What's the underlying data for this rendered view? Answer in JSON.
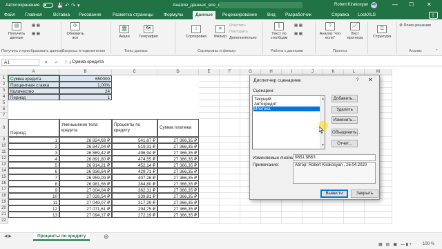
{
  "titlebar": {
    "autosave": "Автосохранение",
    "toggle_state": "Откл.",
    "doc_title": "Анализ_данных_все_функции.xlsx",
    "search_placeholder": "",
    "user": "Robert Kirakosyan",
    "initials": "RK",
    "minimize": "—",
    "maximize": "☐",
    "close": "✕"
  },
  "tabs": [
    "Файл",
    "Главная",
    "Вставка",
    "Рисование",
    "Разметка страницы",
    "Формулы",
    "Данные",
    "Рецензирование",
    "Вид",
    "Разработчик",
    "Справка",
    "LockXLS"
  ],
  "active_tab": "Данные",
  "share_label": "",
  "ribbon": {
    "get_data": "Получить\nданные",
    "refresh_all": "Обновить\nвсе",
    "stocks": "Акции",
    "geography": "География",
    "sort": "Сортировка",
    "filter": "Фильтр",
    "clear": "Очистить",
    "reapply": "Повторить",
    "advanced": "Дополнительно",
    "text_to_columns": "Текст по\nстолбцам",
    "what_if": "Анализ \"что\nесли\"",
    "forecast_sheet": "Лист\nпрогноза",
    "outline": "Структура",
    "solver": "Поиск решения",
    "groups": [
      "Получить и преобразовать данные",
      "Запросы и подключения",
      "Типы данных",
      "Сортировка и фильтр",
      "Работа с данными",
      "Прогноз",
      "Анализ"
    ]
  },
  "formula_bar": {
    "namebox": "A1",
    "controls": "✕ ✓ fx",
    "value": "Сумма кредита"
  },
  "columns": [
    "A",
    "B",
    "C",
    "D",
    "E",
    "F",
    "G",
    "H",
    "I",
    "J",
    "K",
    "L",
    "M"
  ],
  "rows": [
    "1",
    "2",
    "3",
    "4",
    "5",
    "6",
    "7",
    "8",
    "9",
    "10",
    "11",
    "12",
    "13",
    "14",
    "15",
    "16",
    "17",
    "18",
    "19",
    "20",
    "21",
    "22"
  ],
  "params": [
    {
      "label": "Сумма кредита",
      "value": "650000"
    },
    {
      "label": "Процентная ставка",
      "value": "1,00%"
    },
    {
      "label": "Количество",
      "value": "24"
    },
    {
      "label": "Период",
      "value": "1"
    }
  ],
  "table": {
    "headers": [
      "Период",
      "Уменьшение тела кредита",
      "Проценты по кредиту",
      "Сумма платежа"
    ],
    "rows": [
      [
        "1",
        "26 824,69 ₽",
        "541,67 ₽",
        "27 366,35 ₽"
      ],
      [
        "2",
        "26 847,04 ₽",
        "519,31 ₽",
        "27 366,35 ₽"
      ],
      [
        "3",
        "26 869,42 ₽",
        "496,94 ₽",
        "27 366,35 ₽"
      ],
      [
        "4",
        "26 891,80 ₽",
        "474,55 ₽",
        "27 366,35 ₽"
      ],
      [
        "5",
        "26 914,21 ₽",
        "452,14 ₽",
        "27 366,35 ₽"
      ],
      [
        "6",
        "26 936,64 ₽",
        "429,71 ₽",
        "27 366,35 ₽"
      ],
      [
        "7",
        "26 959,09 ₽",
        "407,26 ₽",
        "27 366,35 ₽"
      ],
      [
        "8",
        "26 981,56 ₽",
        "384,80 ₽",
        "27 366,35 ₽"
      ],
      [
        "9",
        "27 004,04 ₽",
        "362,31 ₽",
        "27 366,35 ₽"
      ],
      [
        "10",
        "27 026,54 ₽",
        "339,81 ₽",
        "27 366,35 ₽"
      ],
      [
        "11",
        "27 049,07 ₽",
        "317,29 ₽",
        "27 366,35 ₽"
      ],
      [
        "12",
        "27 071,61 ₽",
        "294,75 ₽",
        "27 366,35 ₽"
      ],
      [
        "13",
        "27 094,17 ₽",
        "272,19 ₽",
        "27 366,35 ₽"
      ]
    ]
  },
  "sheet_tab": "Проценты по кредиту",
  "status": {
    "zoom": "100 %"
  },
  "dialog": {
    "title": "Диспетчер сценариев",
    "help": "?",
    "close": "✕",
    "scenarios_label": "Сценарии:",
    "scenarios": [
      "Текущий",
      "Автокредит",
      "Ипотека"
    ],
    "selected": 2,
    "buttons": [
      "Добавить...",
      "Удалить",
      "Изменить...",
      "Объединить...",
      "Отчет..."
    ],
    "changing_cells_label": "Изменяемые ячейки:",
    "changing_cells": "$B$1:$B$3",
    "comment_label": "Примечание:",
    "comment": "Автор: Robert Kirakosyan , 26.04.2020",
    "show": "Вывести",
    "close_btn": "Закрыть"
  }
}
